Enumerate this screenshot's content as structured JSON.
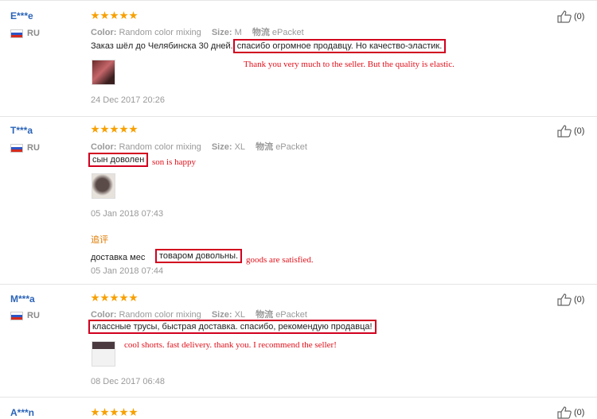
{
  "reviews": [
    {
      "user": "E***e",
      "country": "RU",
      "color_label": "Color:",
      "color_value": "Random color mixing",
      "size_label": "Size:",
      "size_value": "M",
      "ship_label": "物流",
      "ship_value": "ePacket",
      "text_plain": "Заказ шёл до Челябинска 30 дней.",
      "text_boxed": "спасибо огромное продавцу. Но качество-эластик.",
      "translation": "Thank you very much to the seller. But the quality is elastic.",
      "date": "24 Dec 2017 20:26",
      "likes": "(0)"
    },
    {
      "user": "T***a",
      "country": "RU",
      "color_label": "Color:",
      "color_value": "Random color mixing",
      "size_label": "Size:",
      "size_value": "XL",
      "ship_label": "物流",
      "ship_value": "ePacket",
      "text_boxed": "сын доволен",
      "translation": "son is happy",
      "date": "05 Jan 2018 07:43",
      "additional_label": "追评",
      "additional_plain": "доставка мес",
      "additional_boxed": "товаром довольны.",
      "additional_translation": "goods are satisfied.",
      "additional_date": "05 Jan 2018 07:44",
      "likes": "(0)"
    },
    {
      "user": "M***a",
      "country": "RU",
      "color_label": "Color:",
      "color_value": "Random color mixing",
      "size_label": "Size:",
      "size_value": "XL",
      "ship_label": "物流",
      "ship_value": "ePacket",
      "text_boxed": "классные трусы, быстрая доставка. спасибо, рекомендую продавца!",
      "translation": "cool shorts. fast delivery. thank you. I recommend the seller!",
      "date": "08 Dec 2017 06:48",
      "likes": "(0)"
    },
    {
      "user": "A***n",
      "likes": "(0)"
    }
  ]
}
